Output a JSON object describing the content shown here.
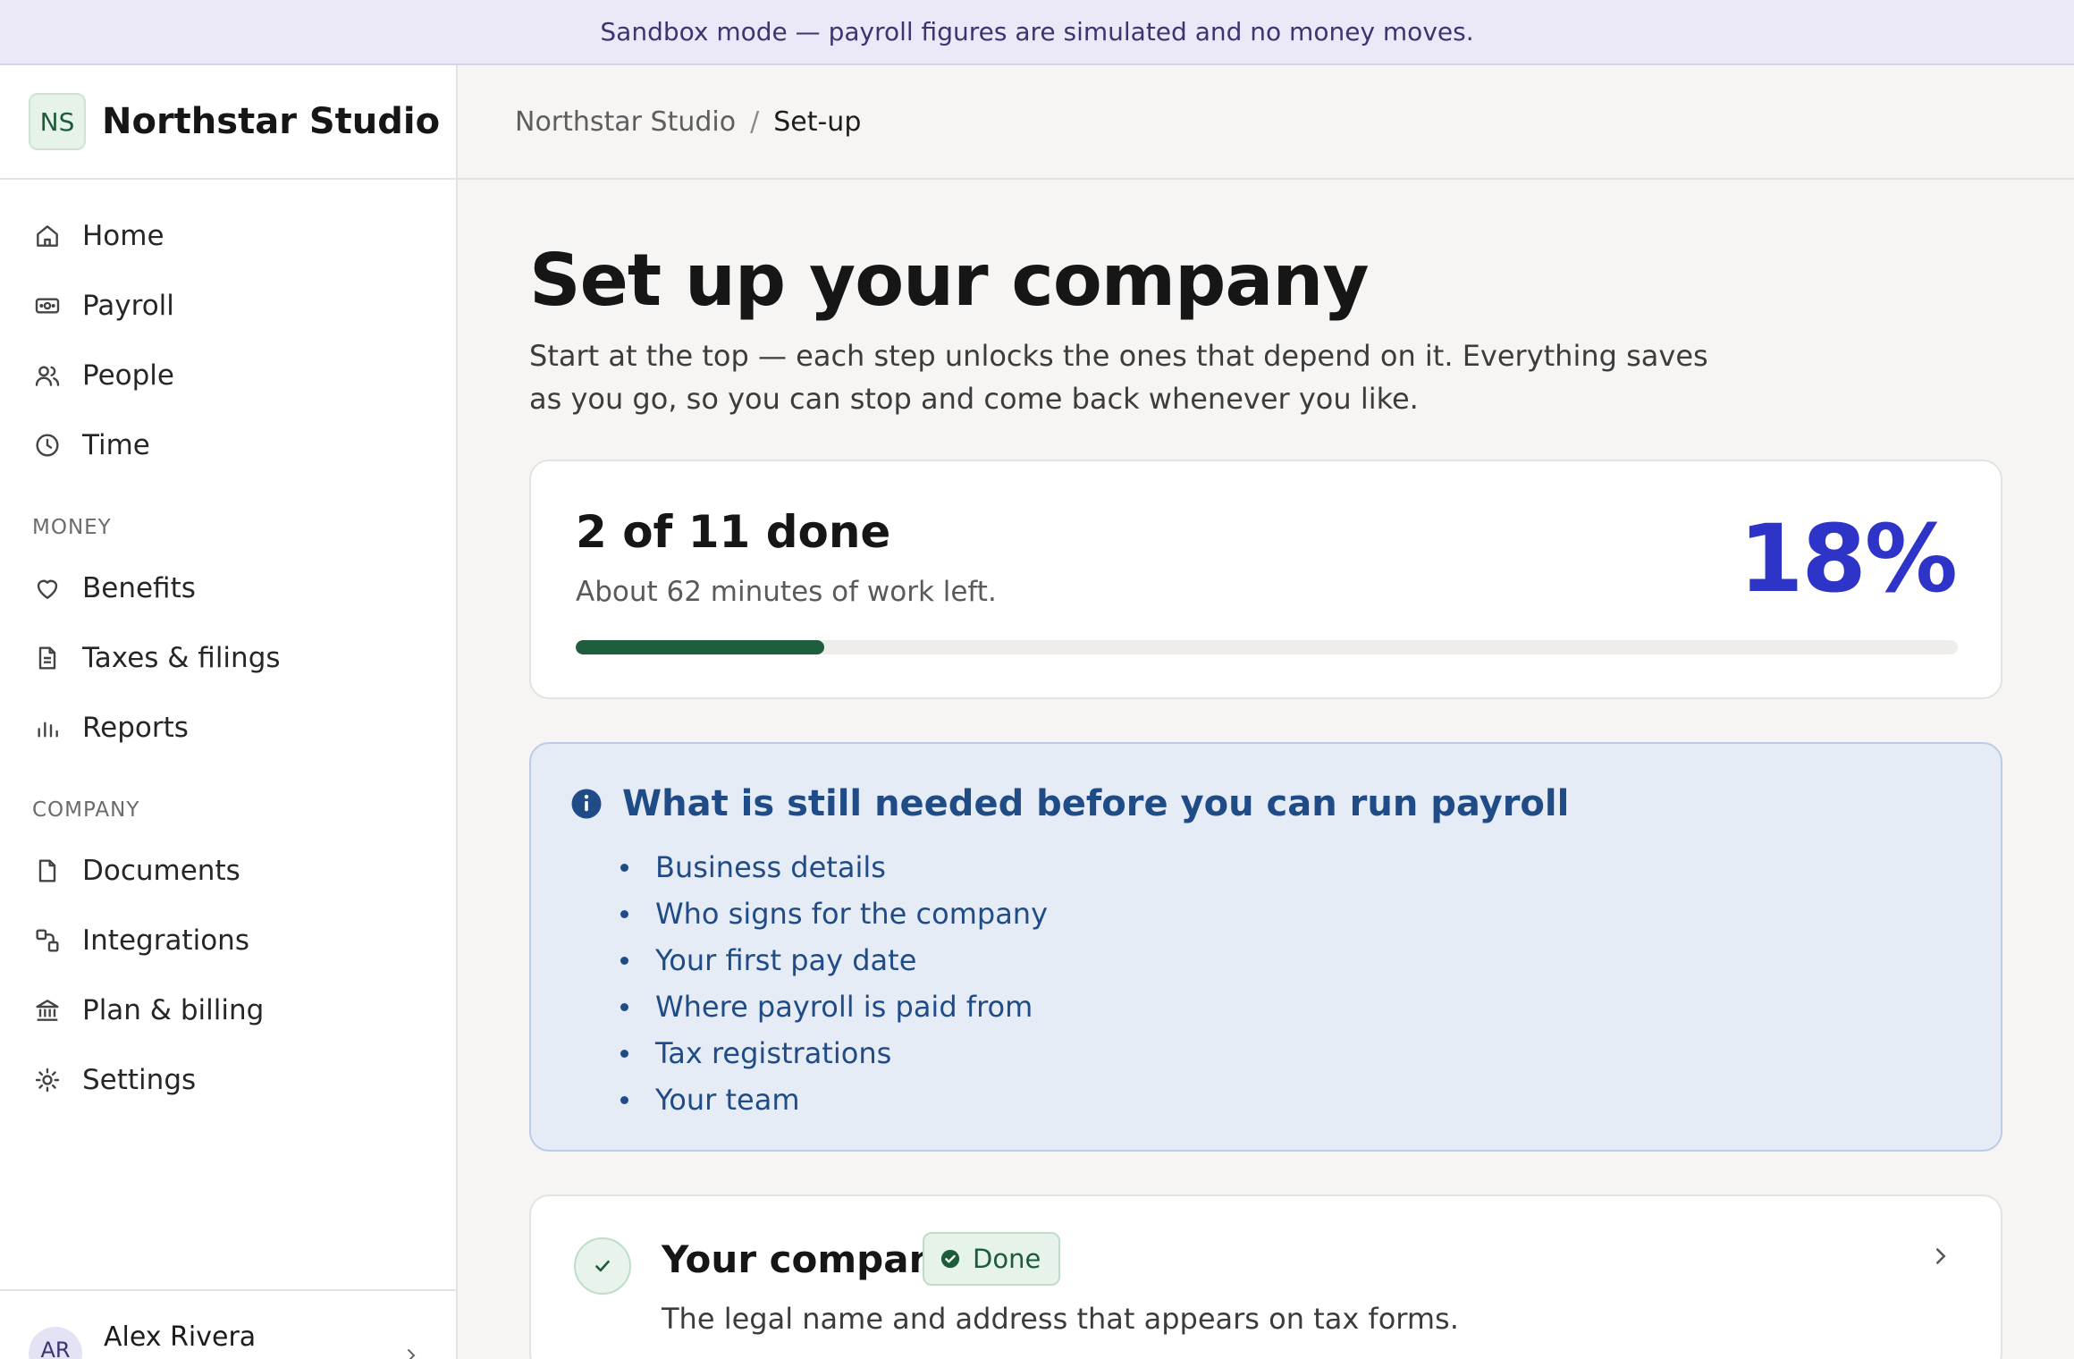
{
  "banner": {
    "text": "Sandbox mode — payroll figures are simulated and no money moves."
  },
  "brand": {
    "initials": "NS",
    "name": "Northstar Studio"
  },
  "sidebar": {
    "main_items": [
      {
        "label": "Home",
        "icon": "home-icon"
      },
      {
        "label": "Payroll",
        "icon": "banknote-icon"
      },
      {
        "label": "People",
        "icon": "users-icon"
      },
      {
        "label": "Time",
        "icon": "clock-icon"
      }
    ],
    "money_label": "MONEY",
    "money_items": [
      {
        "label": "Benefits",
        "icon": "heart-icon"
      },
      {
        "label": "Taxes & filings",
        "icon": "file-text-icon"
      },
      {
        "label": "Reports",
        "icon": "bar-chart-icon"
      }
    ],
    "company_label": "COMPANY",
    "company_items": [
      {
        "label": "Documents",
        "icon": "document-icon"
      },
      {
        "label": "Integrations",
        "icon": "integrations-icon"
      },
      {
        "label": "Plan & billing",
        "icon": "bank-icon"
      },
      {
        "label": "Settings",
        "icon": "gear-icon"
      }
    ],
    "user": {
      "initials": "AR",
      "name": "Alex Rivera"
    }
  },
  "breadcrumb": {
    "root": "Northstar Studio",
    "separator": "/",
    "current": "Set-up"
  },
  "page": {
    "title": "Set up your company",
    "subtitle": "Start at the top — each step unlocks the ones that depend on it. Everything saves as you go, so you can stop and come back whenever you like."
  },
  "progress": {
    "count_text": "2 of 11 done",
    "time_text": "About 62 minutes of work left.",
    "percent_text": "18%",
    "fraction": 0.18,
    "fill_color": "#1f5e3d",
    "accent_color": "#2f34c8"
  },
  "info": {
    "title": "What is still needed before you can run payroll",
    "items": [
      "Business details",
      "Who signs for the company",
      "Your first pay date",
      "Where payroll is paid from",
      "Tax registrations",
      "Your team"
    ]
  },
  "steps": [
    {
      "title": "Your company",
      "status": "Done",
      "description": "The legal name and address that appears on tax forms."
    }
  ]
}
